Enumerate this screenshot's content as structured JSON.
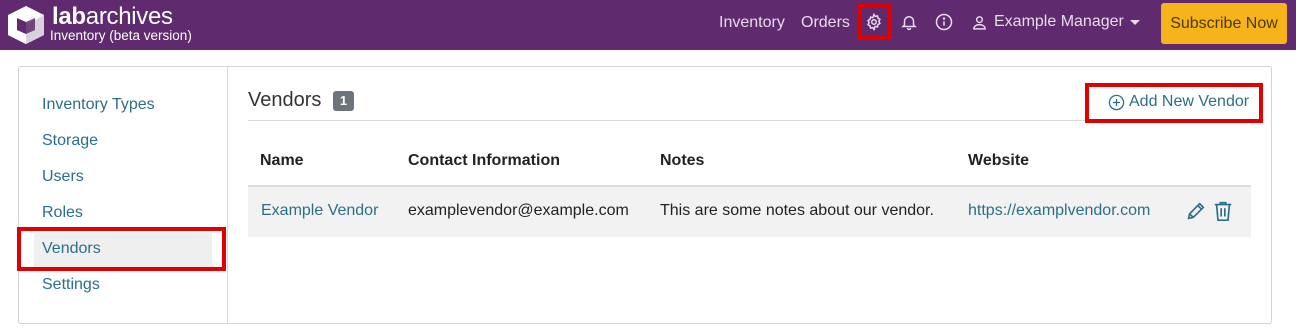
{
  "app": {
    "brand_lab": "lab",
    "brand_archives": "archives",
    "subtitle": "Inventory (beta version)"
  },
  "nav": {
    "inventory": "Inventory",
    "orders": "Orders",
    "user": "Example Manager",
    "subscribe": "Subscribe Now"
  },
  "sidebar": {
    "items": [
      {
        "label": "Inventory Types"
      },
      {
        "label": "Storage"
      },
      {
        "label": "Users"
      },
      {
        "label": "Roles"
      },
      {
        "label": "Vendors"
      },
      {
        "label": "Settings"
      }
    ]
  },
  "main": {
    "title": "Vendors",
    "count": "1",
    "add_label": "Add New Vendor",
    "columns": [
      "Name",
      "Contact Information",
      "Notes",
      "Website"
    ],
    "rows": [
      {
        "name": "Example Vendor",
        "contact": "examplevendor@example.com",
        "notes": "This are some notes about our vendor.",
        "website": "https://examplvendor.com"
      }
    ]
  },
  "colors": {
    "nav_bg": "#5f2a6e",
    "accent_link": "#2b6f87",
    "subscribe_bg": "#f6b31a",
    "highlight": "#e00000"
  }
}
